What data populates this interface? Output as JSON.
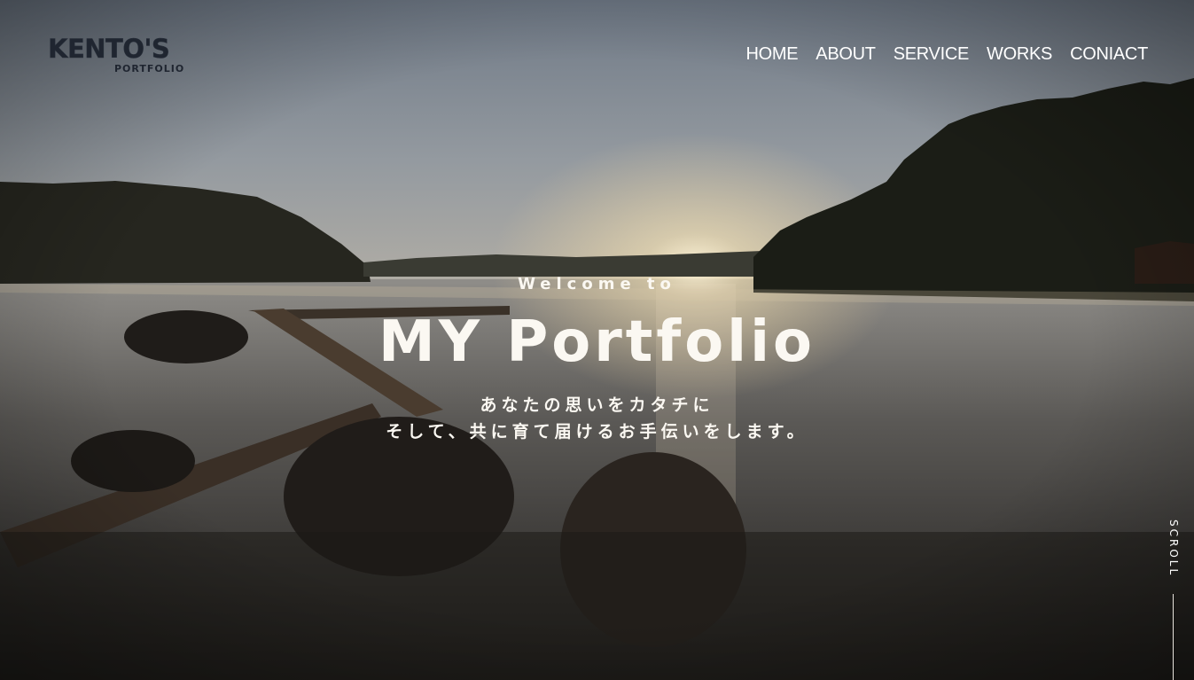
{
  "header": {
    "logo_main": "KENTO'S",
    "logo_sub": "PORTFOLIO",
    "nav": [
      "HOME",
      "ABOUT",
      "SERVICE",
      "WORKS",
      "CONIACT"
    ]
  },
  "hero": {
    "welcome": "Welcome to",
    "title": "MY Portfolio",
    "tagline_line1": "あなたの思いをカタチに",
    "tagline_line2": "そして、共に育て届けるお手伝いをします。"
  },
  "scroll": {
    "label": "SCROLL"
  },
  "colors": {
    "sky": "#8a929b",
    "water": "#6d6a66",
    "text": "#fbf8f2",
    "logo": "#1f2530"
  }
}
